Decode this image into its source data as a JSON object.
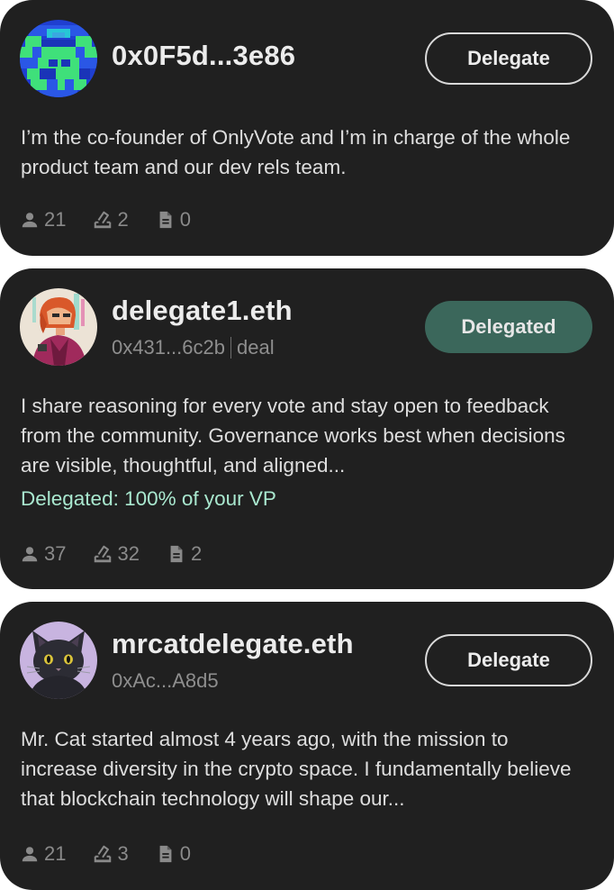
{
  "delegates": [
    {
      "name": "0x0F5d...3e86",
      "address": "",
      "tag": "",
      "button": "Delegate",
      "bio": "I’m the co-founder of OnlyVote and I’m in charge of the whole product team and our dev rels team.",
      "status": "",
      "stats": {
        "delegators": "21",
        "votes": "2",
        "proposals": "0"
      }
    },
    {
      "name": "delegate1.eth",
      "address": "0x431...6c2b",
      "tag": "deal",
      "button": "Delegated",
      "bio": "I share reasoning for every vote and stay open to feedback from the community. Governance works best when decisions are visible, thoughtful, and aligned...",
      "status": "Delegated: 100% of your VP",
      "stats": {
        "delegators": "37",
        "votes": "32",
        "proposals": "2"
      }
    },
    {
      "name": "mrcatdelegate.eth",
      "address": "0xAc...A8d5",
      "tag": "",
      "button": "Delegate",
      "bio": "Mr. Cat started almost 4 years ago, with the mission to increase diversity in the crypto space. I fundamentally believe that blockchain technology will shape our...",
      "status": "",
      "stats": {
        "delegators": "21",
        "votes": "3",
        "proposals": "0"
      }
    }
  ],
  "icons": {
    "delegators": "user-icon",
    "votes": "ballot-icon",
    "proposals": "document-icon"
  },
  "colors": {
    "card_bg": "#202020",
    "delegated_button": "#3b675b",
    "status_text": "#a9e8cf",
    "muted_text": "#8a8a8a"
  }
}
